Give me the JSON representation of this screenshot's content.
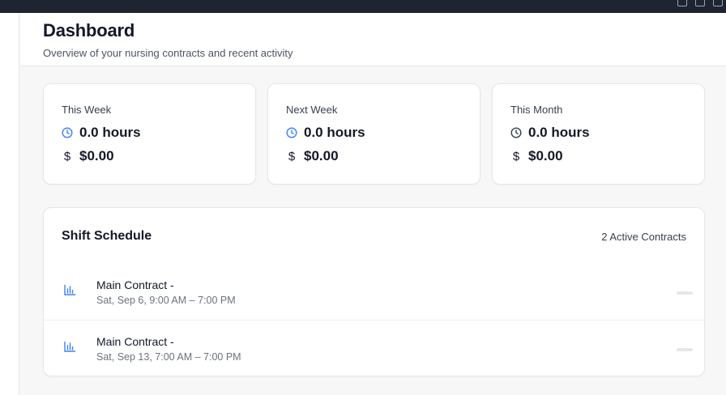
{
  "header": {
    "title": "Dashboard",
    "subtitle": "Overview of your nursing contracts and recent activity"
  },
  "stats": [
    {
      "label": "This Week",
      "hours": "0.0 hours",
      "amount": "$0.00",
      "currency_symbol": "$",
      "icon": "clock-icon",
      "icon_color": "#3b82f6"
    },
    {
      "label": "Next Week",
      "hours": "0.0 hours",
      "amount": "$0.00",
      "currency_symbol": "$",
      "icon": "clock-icon",
      "icon_color": "#3b82f6"
    },
    {
      "label": "This Month",
      "hours": "0.0 hours",
      "amount": "$0.00",
      "currency_symbol": "$",
      "icon": "clock-icon",
      "icon_color": "#374151"
    }
  ],
  "schedule": {
    "title": "Shift Schedule",
    "active_contracts": "2 Active Contracts",
    "shifts": [
      {
        "title": "Main Contract -",
        "time": "Sat, Sep 6, 9:00 AM – 7:00 PM",
        "icon": "bar-chart-icon"
      },
      {
        "title": "Main Contract -",
        "time": "Sat, Sep 13, 7:00 AM – 7:00 PM",
        "icon": "bar-chart-icon"
      }
    ]
  },
  "colors": {
    "accent": "#3b82f6",
    "text_primary": "#111827",
    "text_secondary": "#6b7280",
    "background": "#f7f7f8",
    "topbar": "#1f2430"
  }
}
